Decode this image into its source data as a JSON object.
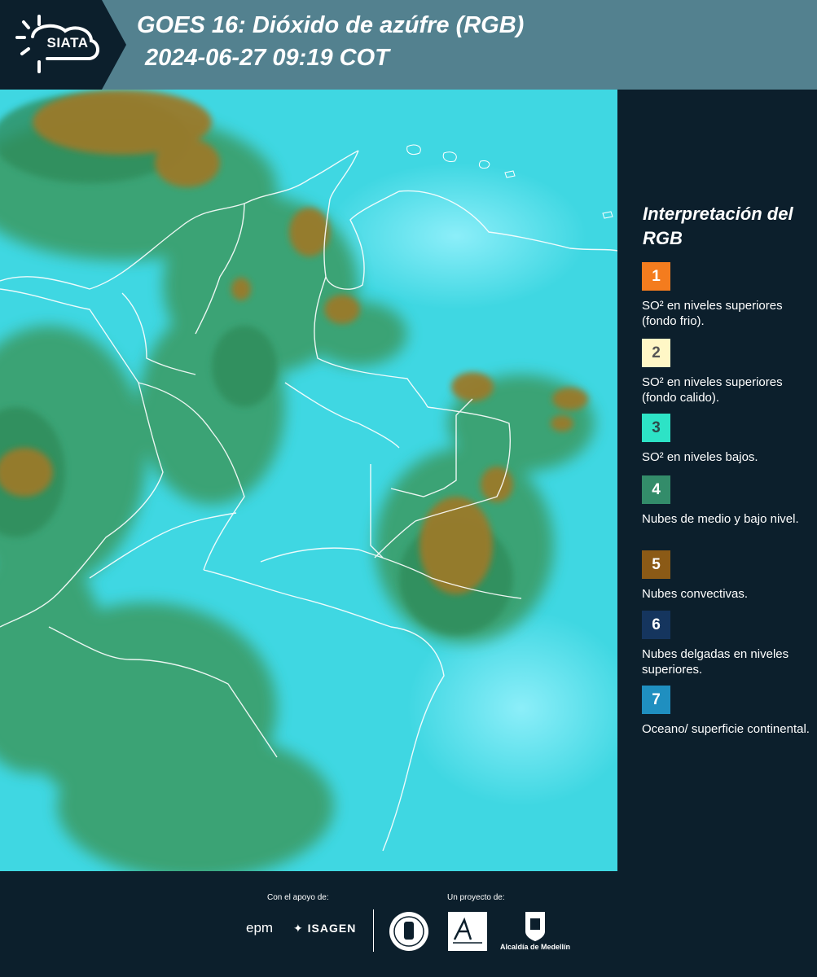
{
  "header": {
    "logo_text": "SIATA",
    "title_line1": "GOES 16: Dióxido de azúfre (RGB)",
    "title_line2": "2024-06-27 09:19 COT"
  },
  "legend": {
    "title": "Interpretación del RGB",
    "items": [
      {
        "number": "1",
        "color": "#f47c1e",
        "number_color": "#ffffff",
        "label": "SO² en niveles superiores (fondo frio)."
      },
      {
        "number": "2",
        "color": "#fff7c6",
        "number_color": "#555555",
        "label": "SO² en niveles superiores (fondo calido)."
      },
      {
        "number": "3",
        "color": "#2de3c6",
        "number_color": "#2b4a4a",
        "label": "SO² en niveles bajos."
      },
      {
        "number": "4",
        "color": "#338c6a",
        "number_color": "#ffffff",
        "label": "Nubes de medio y bajo nivel."
      },
      {
        "number": "5",
        "color": "#8b5a16",
        "number_color": "#ffffff",
        "label": "Nubes convectivas."
      },
      {
        "number": "6",
        "color": "#15355e",
        "number_color": "#ffffff",
        "label": "Nubes delgadas en niveles superiores."
      },
      {
        "number": "7",
        "color": "#1f8fc0",
        "number_color": "#ffffff",
        "label": "Oceano/ superficie continental."
      }
    ]
  },
  "footer": {
    "support_label": "Con el apoyo de:",
    "project_label": "Un proyecto de:",
    "epm": "epm",
    "isagen": "ISAGEN",
    "alcaldia": "Alcaldía de Medellín"
  },
  "colors": {
    "header_bg": "#53818f",
    "panel_bg": "#0c1f2c",
    "map_cyan": "#3fd7e2",
    "cloud_green": "#3a9a62",
    "cloud_brown": "#9a7a2a"
  }
}
